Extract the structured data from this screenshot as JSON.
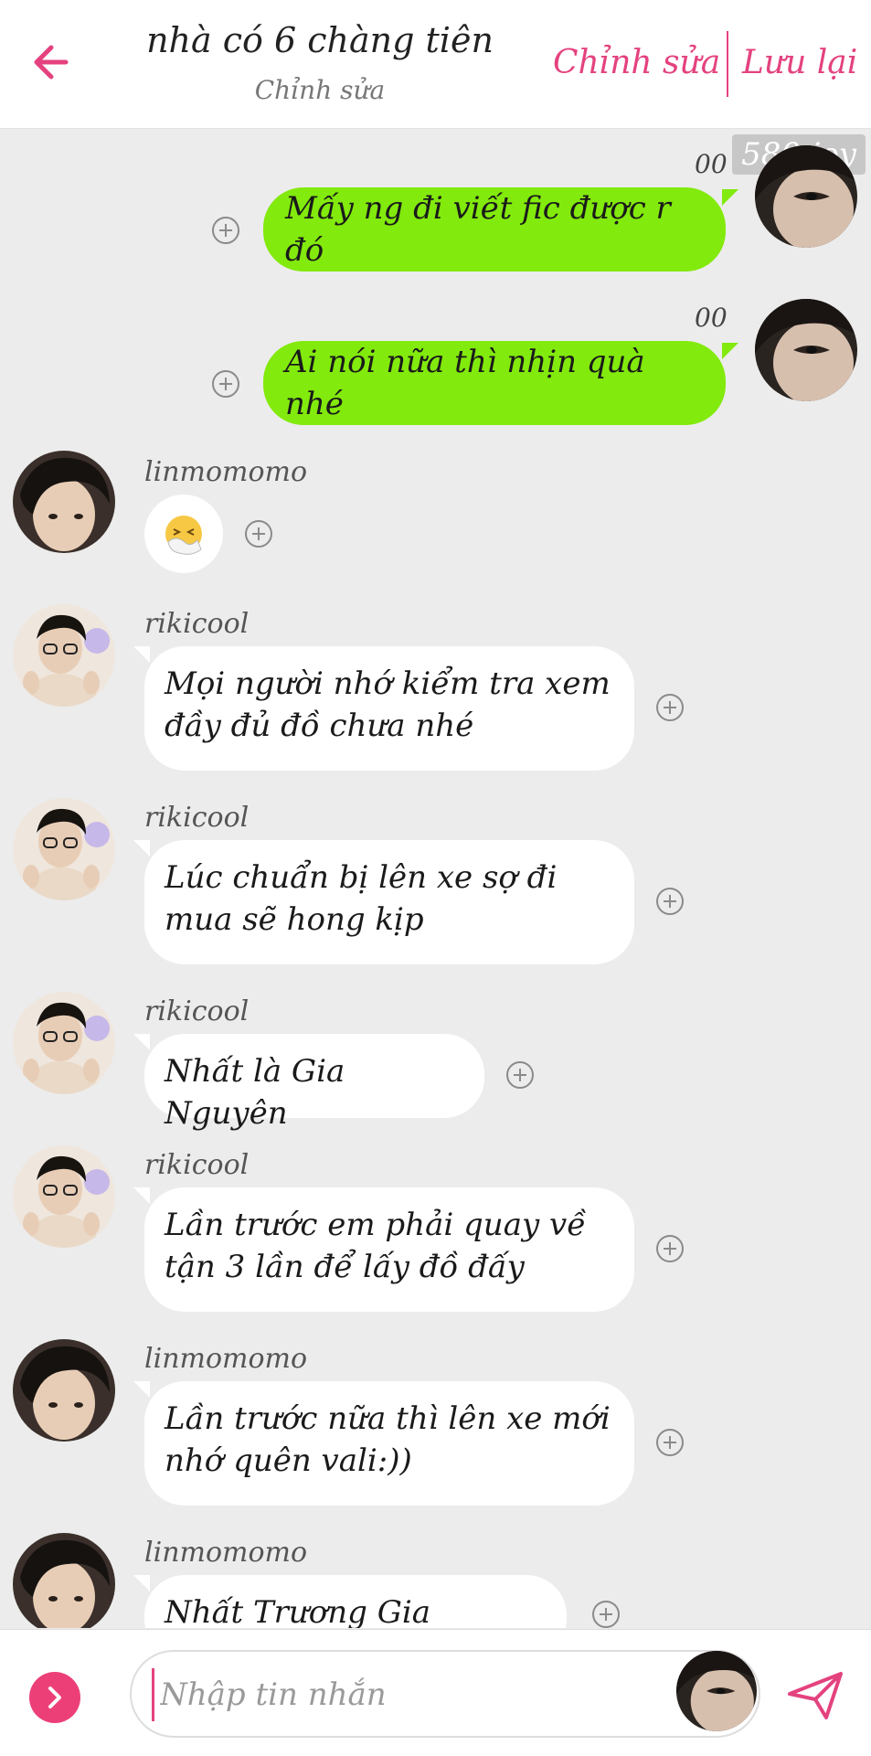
{
  "header": {
    "title": "nhà có 6 chàng tiên",
    "subtitle": "Chỉnh sửa",
    "edit_label": "Chỉnh sửa",
    "save_label": "Lưu lại",
    "back_icon": "arrow-left-icon"
  },
  "watermark": "580 joy",
  "messages": [
    {
      "side": "out",
      "text": "Mấy ng đi viết fic được r đó",
      "read": "00"
    },
    {
      "side": "out",
      "text": "Ai nói nữa thì nhịn quà nhé",
      "read": "00"
    },
    {
      "side": "in",
      "sender": "linmomomo",
      "emoji": "sneezing-face",
      "text": "🤧"
    },
    {
      "side": "in",
      "sender": "rikicool",
      "text": "Mọi người nhớ kiểm tra xem đầy đủ đồ chưa nhé"
    },
    {
      "side": "in",
      "sender": "rikicool",
      "text": "Lúc chuẩn bị lên xe sợ đi mua sẽ hong kịp"
    },
    {
      "side": "in",
      "sender": "rikicool",
      "text": "Nhất là Gia Nguyên"
    },
    {
      "side": "in",
      "sender": "rikicool",
      "text": "Lần trước em phải quay về tận 3 lần để lấy đồ đấy"
    },
    {
      "side": "in",
      "sender": "linmomomo",
      "text": "Lần trước nữa thì lên xe mới nhớ quên vali:))"
    },
    {
      "side": "in",
      "sender": "linmomomo",
      "text": "Nhất Trương Gia Nguyên"
    }
  ],
  "composer": {
    "placeholder": "Nhập tin nhắn",
    "expand_icon": "chevron-right-icon",
    "send_icon": "send-icon"
  },
  "colors": {
    "accent": "#e4427f",
    "outgoing_bubble": "#82ea0c",
    "incoming_bubble": "#ffffff",
    "background": "#ececec"
  }
}
